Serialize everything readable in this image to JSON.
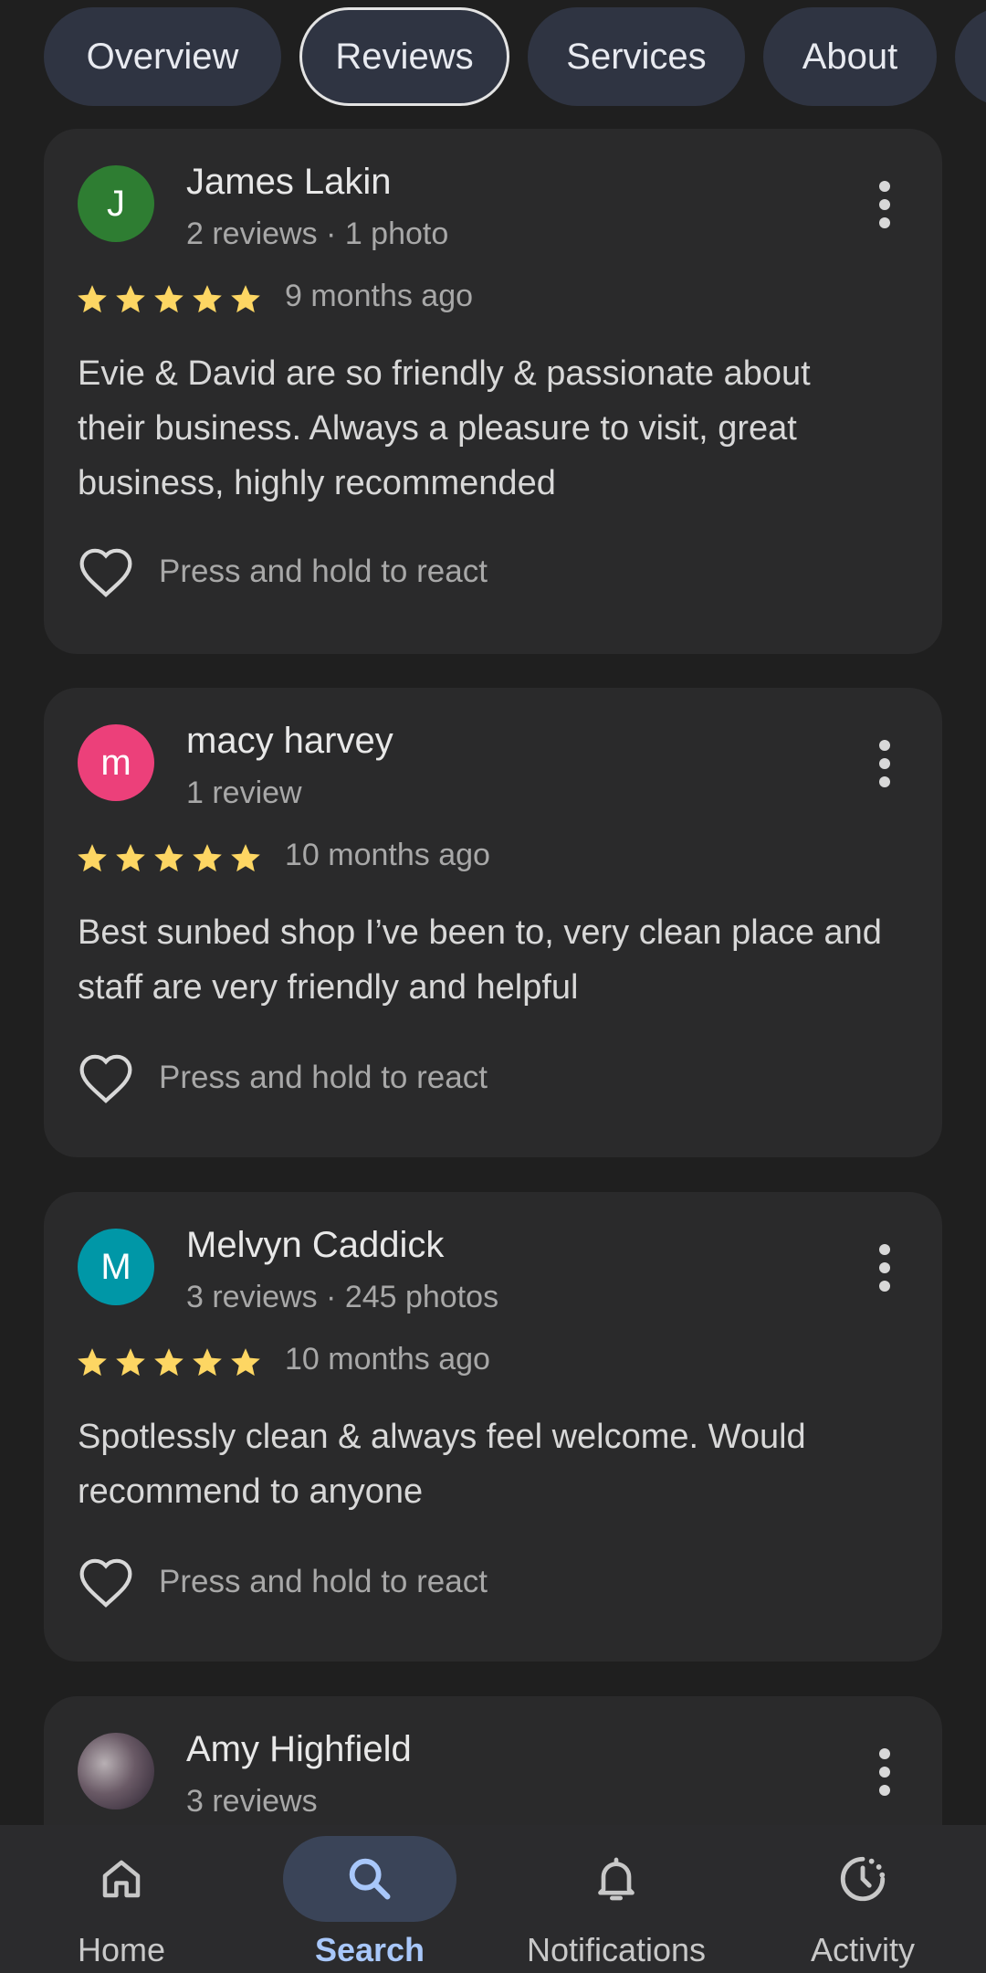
{
  "tabs": [
    {
      "label": "Overview",
      "active": false
    },
    {
      "label": "Reviews",
      "active": true
    },
    {
      "label": "Services",
      "active": false
    },
    {
      "label": "About",
      "active": false
    }
  ],
  "reviews": [
    {
      "avatar_initial": "J",
      "avatar_color": "#2e7d32",
      "name": "James Lakin",
      "meta": "2 reviews · 1 photo",
      "rating": 5,
      "time": "9 months ago",
      "text": "Evie & David are so friendly & passionate about their business. Always a pleasure to visit, great business, highly recommended",
      "react_label": "Press and hold to react"
    },
    {
      "avatar_initial": "m",
      "avatar_color": "#ec407a",
      "name": "macy harvey",
      "meta": "1 review",
      "rating": 5,
      "time": "10 months ago",
      "text": "Best sunbed shop I’ve been to, very clean place and staff are very friendly and helpful",
      "react_label": "Press and hold to react"
    },
    {
      "avatar_initial": "M",
      "avatar_color": "#0097a7",
      "name": "Melvyn Caddick",
      "meta": "3 reviews · 245 photos",
      "rating": 5,
      "time": "10 months ago",
      "text": "Spotlessly clean & always feel welcome. Would recommend to anyone",
      "react_label": "Press and hold to react"
    },
    {
      "avatar_initial": "",
      "avatar_color": "#5a4a52",
      "name": "Amy Highfield",
      "meta": "3 reviews"
    }
  ],
  "nav": [
    {
      "label": "Home",
      "icon": "home-icon",
      "active": false
    },
    {
      "label": "Search",
      "icon": "search-icon",
      "active": true
    },
    {
      "label": "Notifications",
      "icon": "bell-icon",
      "active": false
    },
    {
      "label": "Activity",
      "icon": "activity-icon",
      "active": false
    }
  ],
  "colors": {
    "star": "#fdd663",
    "active_nav": "#a8c7fa"
  }
}
